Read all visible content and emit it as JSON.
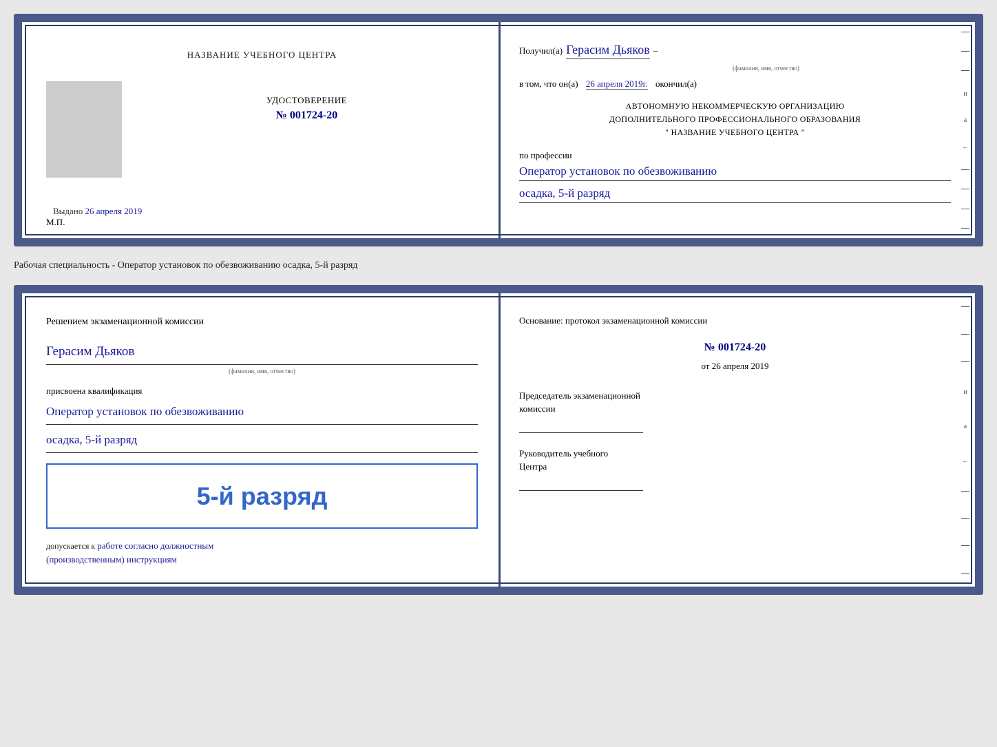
{
  "top_document": {
    "left": {
      "title": "НАЗВАНИЕ УЧЕБНОГО ЦЕНТРА",
      "cert_label": "УДОСТОВЕРЕНИЕ",
      "cert_number_prefix": "№",
      "cert_number": "001724-20",
      "issued_label": "Выдано",
      "issued_date": "26 апреля 2019",
      "mp_label": "М.П."
    },
    "right": {
      "received_prefix": "Получил(а)",
      "recipient_name": "Герасим Дьяков",
      "recipient_sublabel": "(фамилия, имя, отчество)",
      "in_that_prefix": "в том, что он(а)",
      "completion_date": "26 апреля 2019г.",
      "completed_label": "окончил(а)",
      "org_line1": "АВТОНОМНУЮ НЕКОММЕРЧЕСКУЮ ОРГАНИЗАЦИЮ",
      "org_line2": "ДОПОЛНИТЕЛЬНОГО ПРОФЕССИОНАЛЬНОГО ОБРАЗОВАНИЯ",
      "org_line3": "\"    НАЗВАНИЕ УЧЕБНОГО ЦЕНТРА    \"",
      "profession_label": "по профессии",
      "profession_line1": "Оператор установок по обезвоживанию",
      "profession_line2": "осадка, 5-й разряд"
    }
  },
  "separator": {
    "text": "Рабочая специальность - Оператор установок по обезвоживанию осадка, 5-й разряд"
  },
  "bottom_document": {
    "left": {
      "commission_title": "Решением экзаменационной комиссии",
      "person_name": "Герасим Дьяков",
      "person_sublabel": "(фамилия, имя, отчество)",
      "assigned_label": "присвоена квалификация",
      "qualification_line1": "Оператор установок по обезвоживанию",
      "qualification_line2": "осадка, 5-й разряд",
      "rank_display": "5-й разряд",
      "admitted_prefix": "допускается к",
      "admitted_text": "работе согласно должностным",
      "admitted_text2": "(производственным) инструкциям"
    },
    "right": {
      "basis_label": "Основание: протокол экзаменационной комиссии",
      "protocol_number": "№  001724-20",
      "date_prefix": "от",
      "protocol_date": "26 апреля 2019",
      "chairman_label": "Председатель экзаменационной",
      "chairman_label2": "комиссии",
      "director_label": "Руководитель учебного",
      "director_label2": "Центра"
    }
  },
  "edge_marks": {
    "letters": [
      "–",
      "–",
      "–",
      "и",
      "а",
      "←",
      "–",
      "–",
      "–",
      "–"
    ]
  }
}
